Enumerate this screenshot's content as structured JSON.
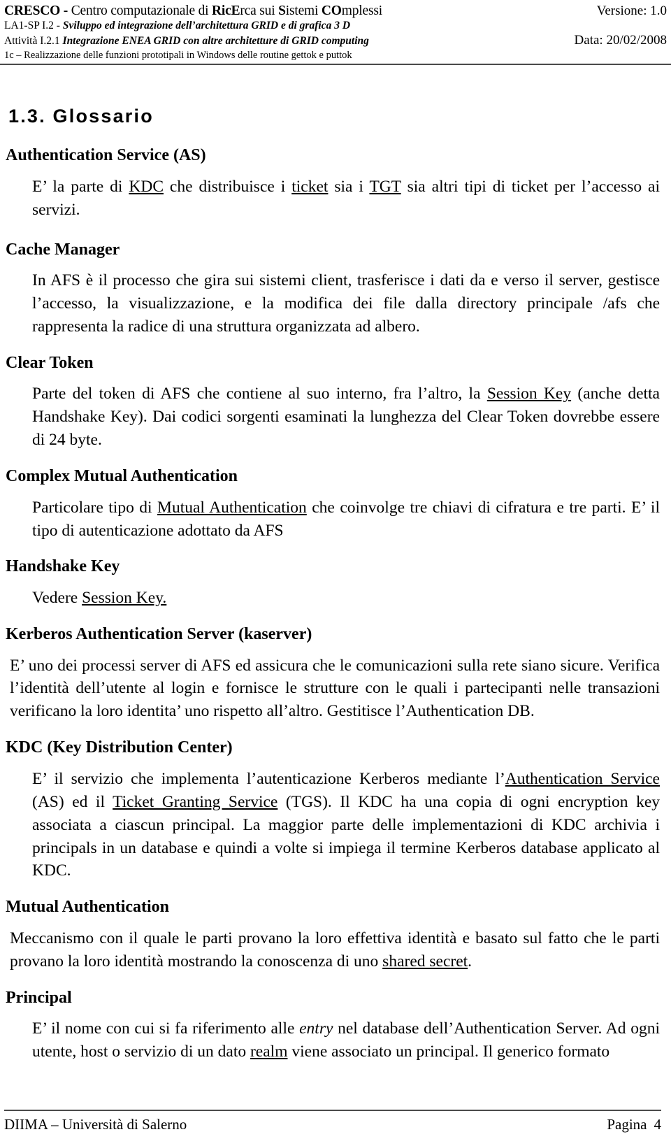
{
  "header": {
    "title_part1": "CRESCO - ",
    "title_part2": "Centro computazionale di ",
    "title_part3": "RicE",
    "title_part4": "rca sui ",
    "title_part5": "S",
    "title_part6": "istemi ",
    "title_part7": "CO",
    "title_part8": "mplessi",
    "title_full": "CRESCO - Centro computazionale di RicErca sui Sistemi COmplessi",
    "version_label": "Versione: 1.0",
    "line2_code": "LA1-SP I.2",
    "line2_sep": "  - ",
    "line2_text": "Sviluppo ed integrazione dell’architettura GRID e di grafica 3 D",
    "line3_code": "Attività I.2.1 ",
    "line3_text": "Integrazione ENEA GRID con altre architetture di GRID computing",
    "date_label": "Data: 20/02/2008",
    "line4_text": "1c – Realizzazione delle funzioni prototipali in Windows delle routine gettok e puttok"
  },
  "section": {
    "heading": "1.3. Glossario"
  },
  "glossary": [
    {
      "term": "Authentication Service (AS)",
      "body_pre": "E’ la parte di ",
      "xref1": "KDC",
      "body_mid1": " che distribuisce i ",
      "xref2": "ticket",
      "body_mid2": " sia i ",
      "xref3": "TGT",
      "body_post": " sia altri tipi di ticket per l’accesso ai servizi."
    },
    {
      "term": "Cache Manager",
      "body": "In AFS è il processo che gira sui sistemi client, trasferisce i dati da e verso il server, gestisce l’accesso, la visualizzazione, e la modifica dei file dalla directory principale /afs che rappresenta la radice di una struttura organizzata ad albero."
    },
    {
      "term": "Clear Token",
      "body_pre": "Parte del token di AFS che contiene al suo interno, fra l’altro, la ",
      "xref1": "Session Key",
      "body_post": " (anche detta Handshake Key). Dai codici sorgenti esaminati la lunghezza del Clear Token dovrebbe essere di 24 byte."
    },
    {
      "term": "Complex Mutual Authentication",
      "body_pre": "Particolare tipo di ",
      "xref1": "Mutual Authentication",
      "body_post": " che coinvolge tre chiavi di cifratura e tre parti. E’ il tipo di autenticazione adottato da AFS"
    },
    {
      "term": "Handshake Key",
      "body_pre": "Vedere ",
      "xref1": "Session Key.",
      "body_post": ""
    },
    {
      "term": "Kerberos Authentication Server (kaserver)",
      "body": "E’ uno dei processi server di AFS ed assicura che le comunicazioni sulla rete siano sicure. Verifica l’identità dell’utente al login e fornisce le strutture con le quali i partecipanti nelle transazioni verificano la loro identita’ uno rispetto all’altro. Gestitisce l’Authentication DB."
    },
    {
      "term": "KDC (Key Distribution Center)",
      "body_pre": "E’ il servizio che implementa l’autenticazione Kerberos mediante l’",
      "xref1": "Authentication Service",
      "body_mid1": " (AS) ed il ",
      "xref2": "Ticket Granting Service",
      "body_post": " (TGS). Il KDC ha una copia di ogni encryption key associata a ciascun principal. La maggior parte delle implementazioni di KDC archivia i principals in un database e quindi a volte si impiega il termine Kerberos database applicato al KDC."
    },
    {
      "term": "Mutual Authentication",
      "body_pre": "Meccanismo con il quale le parti provano la loro effettiva identità e basato sul fatto che le parti provano la loro identità mostrando la conoscenza di uno ",
      "xref1": "shared secret",
      "body_post": "."
    },
    {
      "term": "Principal",
      "body_pre": "E’ il nome con cui si fa riferimento alle ",
      "ital1": "entry",
      "body_mid1": " nel database dell’Authentication Server. Ad ogni utente, host o servizio di un dato ",
      "xref1": "realm",
      "body_post": " viene associato un principal. Il generico formato"
    }
  ],
  "footer": {
    "left": "DIIMA – Università di Salerno",
    "page_label": "Pagina",
    "page_number": "4"
  }
}
